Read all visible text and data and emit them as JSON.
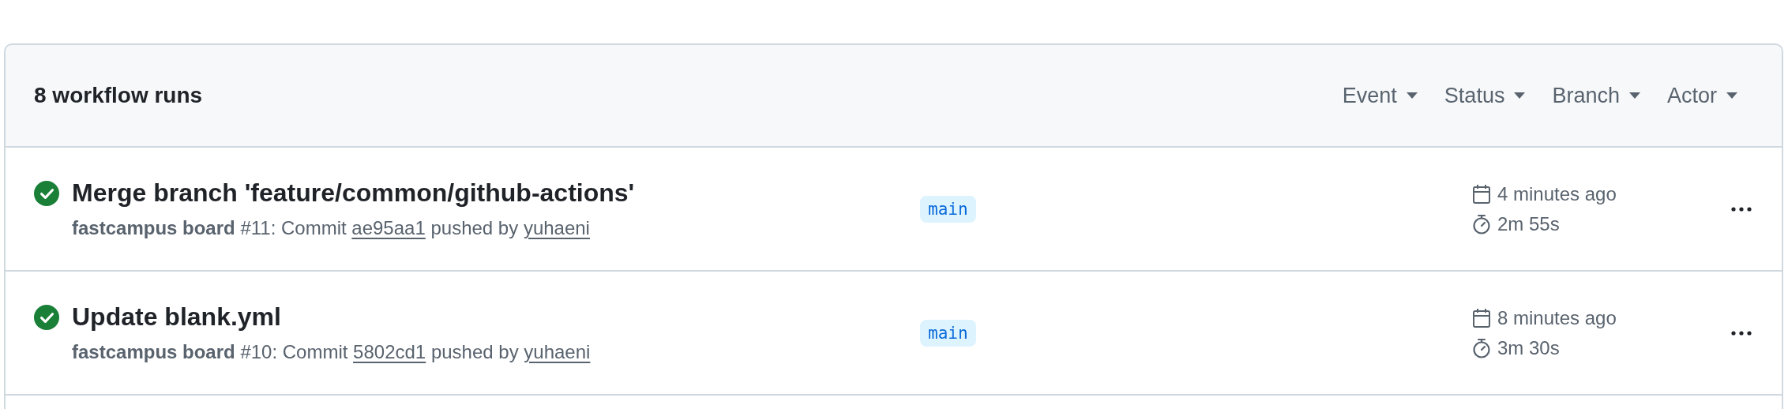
{
  "header": {
    "title": "8 workflow runs",
    "filters": [
      "Event",
      "Status",
      "Branch",
      "Actor"
    ]
  },
  "runs": [
    {
      "passed": true,
      "title": "Merge branch 'feature/common/github-actions'",
      "workflow": "fastcampus board",
      "summary": "#11: Commit",
      "commit": "ae95aa1",
      "pushed": "pushed by",
      "actor": "yuhaeni",
      "branch": "main",
      "time_ago": "4 minutes ago",
      "duration": "2m 55s"
    },
    {
      "passed": true,
      "title": "Update blank.yml",
      "workflow": "fastcampus board",
      "summary": "#10: Commit",
      "commit": "5802cd1",
      "pushed": "pushed by",
      "actor": "yuhaeni",
      "branch": "main",
      "time_ago": "8 minutes ago",
      "duration": "3m 30s"
    }
  ]
}
